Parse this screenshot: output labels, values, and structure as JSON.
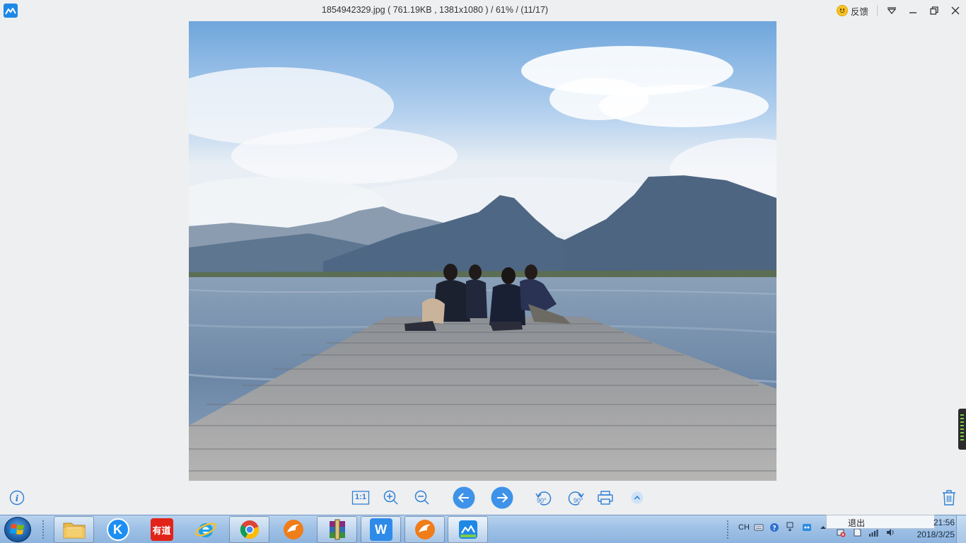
{
  "window": {
    "title": "1854942329.jpg ( 761.19KB , 1381x1080 ) / 61% / (11/17)",
    "feedback_label": "反馈",
    "accent": "#1e88e5"
  },
  "toolbar": {
    "actual_size_label": "1:1",
    "rotate_left_label": "90°",
    "rotate_right_label": "90°",
    "icons": [
      "info-icon",
      "actual-size-icon",
      "zoom-in-icon",
      "zoom-out-icon",
      "prev-arrow-icon",
      "next-arrow-icon",
      "rotate-left-icon",
      "rotate-right-icon",
      "print-icon",
      "expand-up-icon",
      "trash-icon"
    ]
  },
  "taskbar": {
    "apps": [
      "file-explorer",
      "kugou-music",
      "youdao-dictionary",
      "internet-explorer",
      "chrome",
      "foxmail",
      "winrar",
      "wps",
      "foxmail-2",
      "image-viewer"
    ],
    "youdao_label": "有道",
    "kugou_label": "K",
    "wps_label": "W",
    "tray": {
      "lang": "CH",
      "tooltip": "退出",
      "time": "21:56",
      "date": "2018/3/25"
    }
  }
}
